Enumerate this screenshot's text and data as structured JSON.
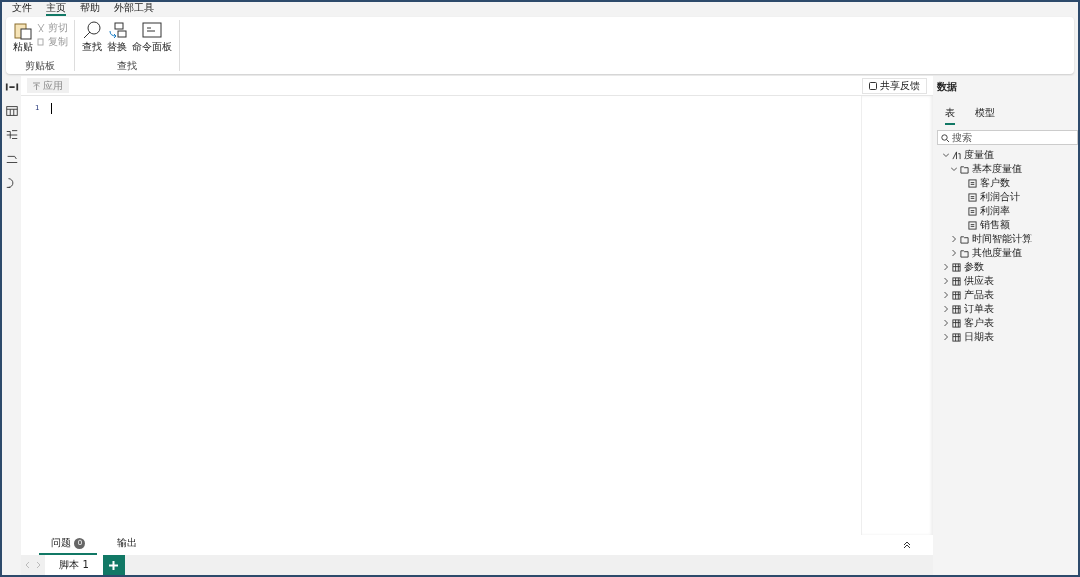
{
  "menu": [
    {
      "label": "文件",
      "selected": false
    },
    {
      "label": "主页",
      "selected": true
    },
    {
      "label": "帮助",
      "selected": false
    },
    {
      "label": "外部工具",
      "selected": false
    }
  ],
  "ribbon": {
    "groups": [
      {
        "label": "剪贴板",
        "buttons": [
          {
            "label": "粘贴",
            "kind": "paste",
            "disabled": false
          },
          {
            "label": "剪切",
            "kind": "cut",
            "disabled": true
          },
          {
            "label": "复制",
            "kind": "copy",
            "disabled": true
          }
        ]
      },
      {
        "label": "查找",
        "buttons": [
          {
            "label": "查找",
            "kind": "find",
            "disabled": false
          },
          {
            "label": "替换",
            "kind": "replace",
            "disabled": false
          },
          {
            "label": "命令面板",
            "kind": "palette",
            "disabled": false
          }
        ]
      }
    ]
  },
  "editor": {
    "apply": {
      "label": "应用",
      "disabled": true
    },
    "feedback": "共享反馈",
    "line_numbers": [
      "1"
    ]
  },
  "data_pane": {
    "title": "数据",
    "tabs": [
      {
        "label": "表",
        "selected": true
      },
      {
        "label": "模型",
        "selected": false
      }
    ],
    "search": {
      "placeholder": "搜索"
    },
    "tree": [
      {
        "label": "度量值",
        "kind": "measures",
        "expanded": true,
        "children": [
          {
            "label": "基本度量值",
            "kind": "folder",
            "expanded": true,
            "children": [
              {
                "label": "客户数",
                "kind": "measure"
              },
              {
                "label": "利润合计",
                "kind": "measure"
              },
              {
                "label": "利润率",
                "kind": "measure"
              },
              {
                "label": "销售额",
                "kind": "measure"
              }
            ]
          },
          {
            "label": "时间智能计算",
            "kind": "folder",
            "expanded": false
          },
          {
            "label": "其他度量值",
            "kind": "folder",
            "expanded": false
          }
        ]
      },
      {
        "label": "参数",
        "kind": "param",
        "expanded": false
      },
      {
        "label": "供应表",
        "kind": "dim",
        "expanded": false
      },
      {
        "label": "产品表",
        "kind": "dim",
        "expanded": false
      },
      {
        "label": "订单表",
        "kind": "fact",
        "expanded": false
      },
      {
        "label": "客户表",
        "kind": "fact",
        "expanded": false
      },
      {
        "label": "日期表",
        "kind": "date",
        "expanded": false
      }
    ]
  },
  "bottom": {
    "tabs": [
      {
        "label": "问题",
        "badge": "0",
        "selected": true
      },
      {
        "label": "输出",
        "selected": false
      }
    ]
  },
  "scripts": [
    {
      "label": "脚本 1",
      "selected": true
    }
  ]
}
